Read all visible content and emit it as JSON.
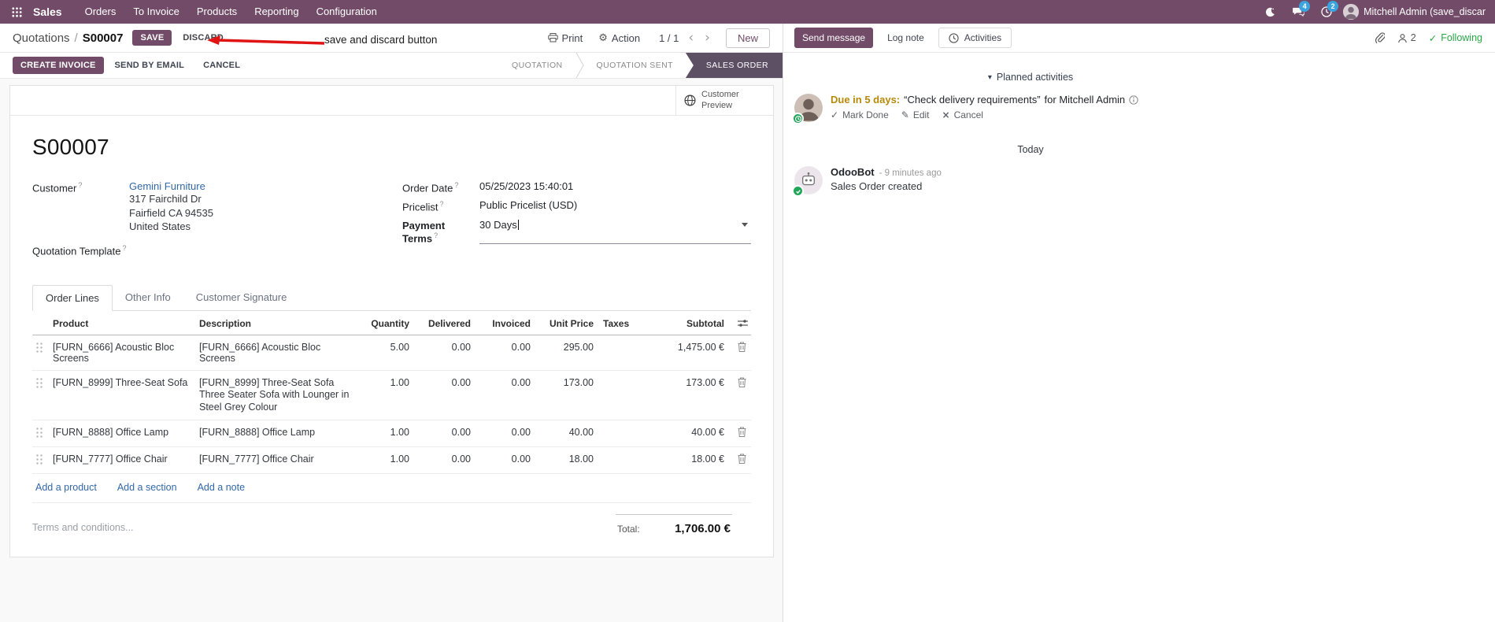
{
  "colors": {
    "brand": "#714B67",
    "topbar_bg": "#714B67",
    "active_stage_bg": "#5d5064",
    "link": "#3268a8",
    "edited_value": "#3268a8",
    "annotation_red": "#e01414",
    "following_green": "#28a745",
    "badge_blue": "#3ba3dd",
    "due_warning": "#b78a0a"
  },
  "icons": {
    "chevron_left": "‹",
    "chevron_right": "›",
    "gear": "⚙",
    "caret_down": "▾",
    "check": "✓",
    "pencil": "✎",
    "cross": "×"
  },
  "topbar": {
    "app_name": "Sales",
    "menus": [
      "Orders",
      "To Invoice",
      "Products",
      "Reporting",
      "Configuration"
    ],
    "messages_badge": "4",
    "activities_badge": "2",
    "user_name": "Mitchell Admin (save_discar"
  },
  "control_panel": {
    "breadcrumb_parent": "Quotations",
    "breadcrumb_separator": "/",
    "breadcrumb_current": "S00007",
    "save_label": "SAVE",
    "discard_label": "DISCARD",
    "annotation_text": "save and discard button",
    "print_label": "Print",
    "action_label": "Action",
    "pager_value": "1 / 1",
    "new_label": "New"
  },
  "statusbar": {
    "create_invoice_label": "CREATE INVOICE",
    "send_by_email_label": "SEND BY EMAIL",
    "cancel_label": "CANCEL",
    "stages": [
      "QUOTATION",
      "QUOTATION SENT",
      "SALES ORDER"
    ],
    "active_stage": "SALES ORDER"
  },
  "form": {
    "help_marker": "?",
    "customer_preview_label": "Customer Preview",
    "title": "S00007",
    "customer_label": "Customer",
    "customer_name": "Gemini Furniture",
    "customer_address1": "317 Fairchild Dr",
    "customer_address2": "Fairfield CA 94535",
    "customer_address3": "United States",
    "quotation_template_label": "Quotation Template",
    "order_date_label": "Order Date",
    "order_date_value": "05/25/2023 15:40:01",
    "pricelist_label": "Pricelist",
    "pricelist_value": "Public Pricelist (USD)",
    "payment_terms_label": "Payment Terms",
    "payment_terms_value": "30 Days",
    "tabs": [
      "Order Lines",
      "Other Info",
      "Customer Signature"
    ],
    "active_tab": "Order Lines"
  },
  "order_lines": {
    "headers": [
      "Product",
      "Description",
      "Quantity",
      "Delivered",
      "Invoiced",
      "Unit Price",
      "Taxes",
      "Subtotal"
    ],
    "rows": [
      {
        "product": "[FURN_6666] Acoustic Bloc Screens",
        "description": "[FURN_6666] Acoustic Bloc Screens",
        "description2": "",
        "quantity": "5.00",
        "delivered": "0.00",
        "invoiced": "0.00",
        "unit_price": "295.00",
        "taxes": "",
        "subtotal": "1,475.00 €"
      },
      {
        "product": "[FURN_8999] Three-Seat Sofa",
        "description": "[FURN_8999] Three-Seat Sofa",
        "description2": "Three Seater Sofa with Lounger in Steel Grey Colour",
        "quantity": "1.00",
        "delivered": "0.00",
        "invoiced": "0.00",
        "unit_price": "173.00",
        "taxes": "",
        "subtotal": "173.00 €"
      },
      {
        "product": "[FURN_8888] Office Lamp",
        "description": "[FURN_8888] Office Lamp",
        "description2": "",
        "quantity": "1.00",
        "delivered": "0.00",
        "invoiced": "0.00",
        "unit_price": "40.00",
        "taxes": "",
        "subtotal": "40.00 €"
      },
      {
        "product": "[FURN_7777] Office Chair",
        "description": "[FURN_7777] Office Chair",
        "description2": "",
        "quantity": "1.00",
        "delivered": "0.00",
        "invoiced": "0.00",
        "unit_price": "18.00",
        "taxes": "",
        "subtotal": "18.00 €"
      }
    ],
    "add_product_label": "Add a product",
    "add_section_label": "Add a section",
    "add_note_label": "Add a note",
    "terms_placeholder": "Terms and conditions...",
    "total_label": "Total:",
    "total_value": "1,706.00 €"
  },
  "chatter": {
    "send_message_label": "Send message",
    "log_note_label": "Log note",
    "activities_label": "Activities",
    "followers_count": "2",
    "following_label": "Following",
    "planned_header": "Planned activities",
    "activity": {
      "due_text": "Due in 5 days:",
      "summary": "“Check delivery requirements”",
      "assignee": "for Mitchell Admin",
      "mark_done_label": "Mark Done",
      "edit_label": "Edit",
      "cancel_label": "Cancel"
    },
    "date_divider": "Today",
    "message": {
      "author": "OdooBot",
      "timestamp": "- 9 minutes ago",
      "body": "Sales Order created"
    }
  }
}
